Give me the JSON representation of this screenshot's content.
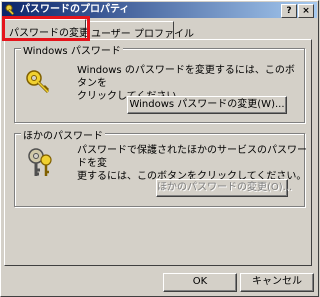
{
  "window": {
    "title": "パスワードのプロパティ",
    "help": "?",
    "close": "×"
  },
  "tabs": [
    {
      "label": "パスワードの変更"
    },
    {
      "label": "ユーザー プロファイル"
    }
  ],
  "windows_password": {
    "legend": "Windows パスワード",
    "description_line1": "Windows のパスワードを変更するには、このボタンを",
    "description_line2": "クリックしてください。",
    "button": "Windows パスワードの変更(W)...",
    "icon": "key-icon"
  },
  "other_password": {
    "legend": "ほかのパスワード",
    "description_line1": "パスワードで保護されたほかのサービスのパスワードを変",
    "description_line2": "更するには、このボタンをクリックしてください。",
    "button": "ほかのパスワードの変更(O)...",
    "icon": "keys-icon"
  },
  "footer": {
    "ok": "OK",
    "cancel": "キャンセル"
  },
  "colors": {
    "highlight": "#e5141b",
    "title_start": "#0a246a",
    "title_end": "#a6caf0"
  }
}
